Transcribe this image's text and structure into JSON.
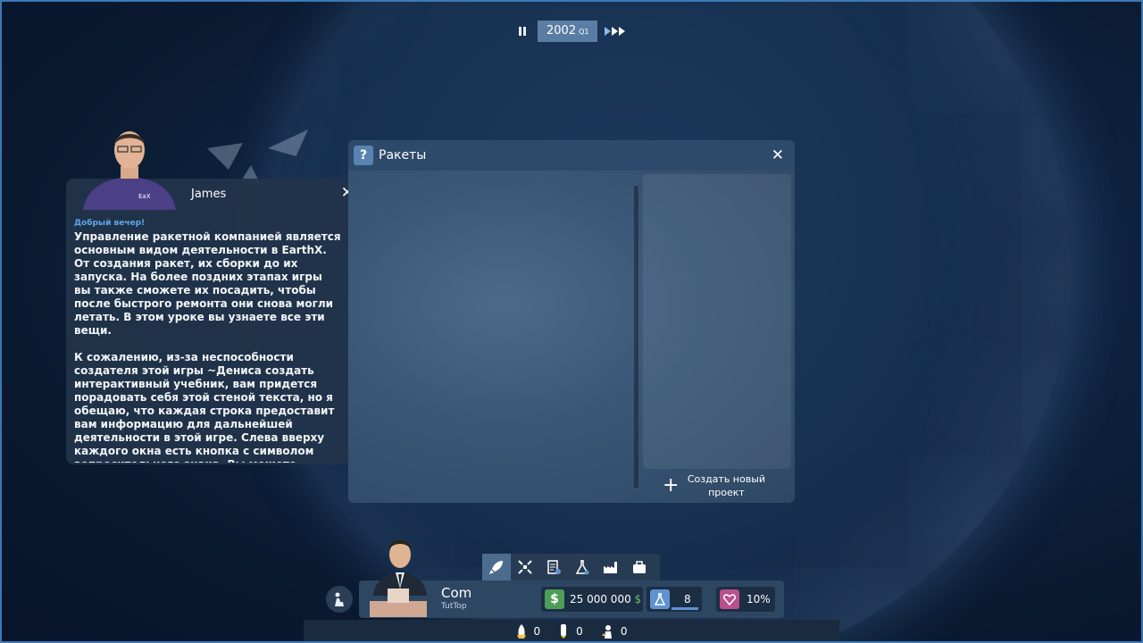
{
  "timebar": {
    "year": "2002",
    "quarter": "Q1"
  },
  "advisor": {
    "name": "James",
    "greeting": "Добрый вечер!",
    "paragraph1": "Управление ракетной компанией является основным видом деятельности в EarthX. От создания ракет, их сборки до их запуска. На более поздних этапах игры вы также сможете их посадить, чтобы после быстрого ремонта они снова могли летать. В этом уроке вы узнаете все эти вещи.",
    "paragraph2": "К сожалению, из-за неспособности создателя этой игры ~Дениса создать интерактивный учебник, вам придется порадовать себя этой стеной текста, но я обещаю, что каждая строка предоставит вам информацию для дальнейшей деятельности в этой игре. Слева вверху каждого окна есть кнопка с символом вопросительного знака. Вы можете нажать на него позже в игре, чтобы снова показать это начальное окно."
  },
  "rockets_window": {
    "title": "Ракеты",
    "help": "?",
    "new_project": "Создать новый проект"
  },
  "status": {
    "company": "Com",
    "company_sub": "TutTop",
    "money_value": "25 000 000",
    "money_currency": "$",
    "money_icon": "$",
    "science_value": "8",
    "reputation_value": "10%"
  },
  "counters": {
    "rockets": "0",
    "boosters": "0",
    "astronauts": "0"
  },
  "icons": {
    "tabs": [
      "rocket-icon",
      "satellite-icon",
      "contracts-icon",
      "research-icon",
      "factory-icon",
      "briefcase-icon"
    ],
    "active_tab": "rocket-icon"
  },
  "colors": {
    "money": "#4f9e58",
    "science": "#5f93d0",
    "reputation": "#b8508e",
    "greeting": "#5ea6e8"
  }
}
